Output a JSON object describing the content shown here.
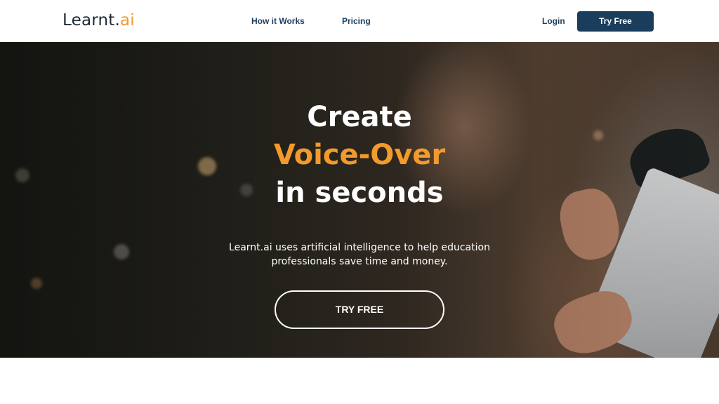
{
  "header": {
    "logo_text": "Learnt.",
    "logo_accent": "ai",
    "nav": {
      "how_it_works": "How it Works",
      "pricing": "Pricing",
      "login": "Login"
    },
    "cta_label": "Try Free"
  },
  "hero": {
    "title_line1": "Create",
    "title_line2": "Voice-Over",
    "title_line3": "in seconds",
    "subtitle_line1": "Learnt.ai uses artificial intelligence to help education",
    "subtitle_line2": "professionals save time and money.",
    "cta_label": "TRY FREE"
  },
  "colors": {
    "brand_dark": "#1a3d5c",
    "accent_orange": "#f39a2c",
    "text_dark": "#1f2a36",
    "white": "#ffffff"
  }
}
